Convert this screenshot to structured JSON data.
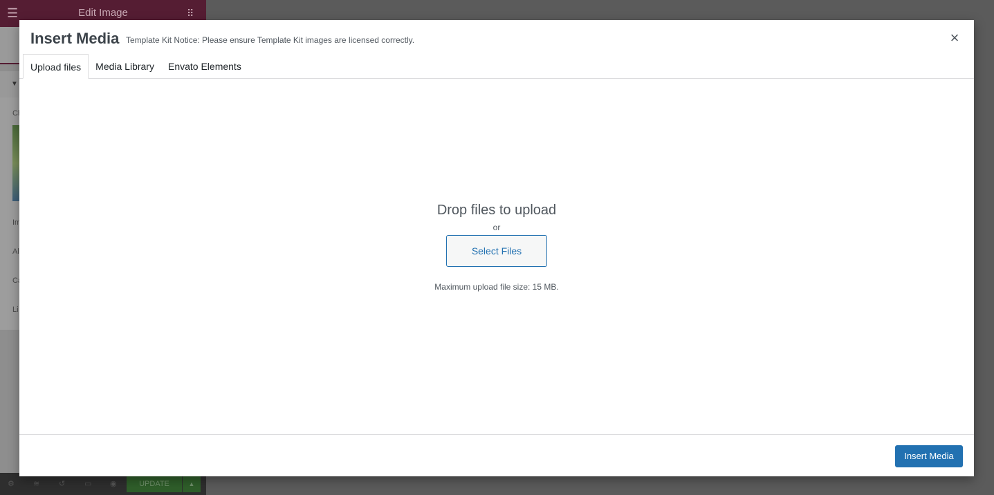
{
  "editor": {
    "header_title": "Edit Image",
    "menu_glyph": "☰",
    "grid_glyph": "⠿",
    "section_caret": "▼",
    "labels": [
      "Ch",
      "Im",
      "Al",
      "Ca",
      "Li"
    ],
    "footer_update": "UPDATE",
    "footer_arrow": "▲",
    "footer_icons": [
      "⚙",
      "≋",
      "↺",
      "▭",
      "◉"
    ]
  },
  "modal": {
    "title": "Insert Media",
    "notice": "Template Kit Notice: Please ensure Template Kit images are licensed correctly.",
    "close_glyph": "×",
    "tabs": [
      {
        "label": "Upload files",
        "active": true
      },
      {
        "label": "Media Library",
        "active": false
      },
      {
        "label": "Envato Elements",
        "active": false
      }
    ],
    "upload": {
      "drop_title": "Drop files to upload",
      "or_text": "or",
      "select_button": "Select Files",
      "max_size": "Maximum upload file size: 15 MB."
    },
    "insert_button": "Insert Media"
  },
  "colors": {
    "overlay": "#5b5b5b",
    "brand": "#551d33",
    "primary": "#2271b1",
    "text": "#3c434a"
  }
}
